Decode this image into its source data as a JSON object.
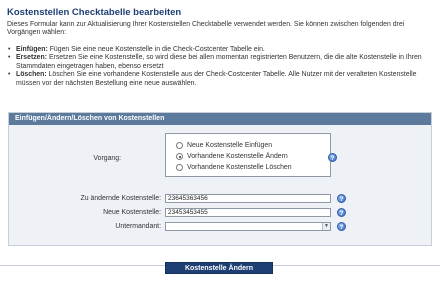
{
  "page": {
    "title": "Kostenstellen Checktabelle bearbeiten",
    "intro": "Dieses Formular kann zur Aktualisierung Ihrer Kostenstellen Checktabelle verwendet werden. Sie können zwischen folgenden drei Vorgängen wählen:",
    "options": [
      {
        "term": "Einfügen:",
        "text": " Fügen Sie eine neue Kostenstelle in die Check-Costcenter Tabelle ein."
      },
      {
        "term": "Ersetzen:",
        "text": " Ersetzen Sie eine Kostenstelle, so wird diese bei allen momentan registrierten Benutzern, die die alte Kostenstelle in Ihren Stammdaten eingetragen haben, ebenso ersetzt"
      },
      {
        "term": "Löschen:",
        "text": " Löschen Sie eine vorhandene Kostenstelle aus der Check-Costcenter Tabelle. Alle Nutzer mit der veralteten Kostenstelle müssen vor der nächsten Bestellung eine neue auswählen."
      }
    ]
  },
  "panel": {
    "header": "Einfügen/Ändern/Löschen von Kostenstellen",
    "vorgang_label": "Vorgang:",
    "radio_options": [
      "Neue Kostenstelle Einfügen",
      "Vorhandene Kostenstelle Ändern",
      "Vorhandene Kostenstelle Löschen"
    ],
    "selected_option": "Vorhandene Kostenstelle Ändern",
    "aendernde_label": "Zu ändernde Kostenstelle:",
    "aendernde_value": "23645363456",
    "neue_label": "Neue Kostenstelle:",
    "neue_value": "23453453455",
    "untermandant_label": "Untermandant:",
    "untermandant_value": "",
    "help_icon": "?"
  },
  "submit": {
    "label": "Kostenstelle Ändern"
  },
  "icons": {
    "help": "help-icon",
    "dropdown": "chevron-down-icon"
  },
  "colors": {
    "title": "#1f3f73",
    "panel_header": "#5b7a9c",
    "button": "#1e3f74",
    "help": "#3a6cc6"
  }
}
